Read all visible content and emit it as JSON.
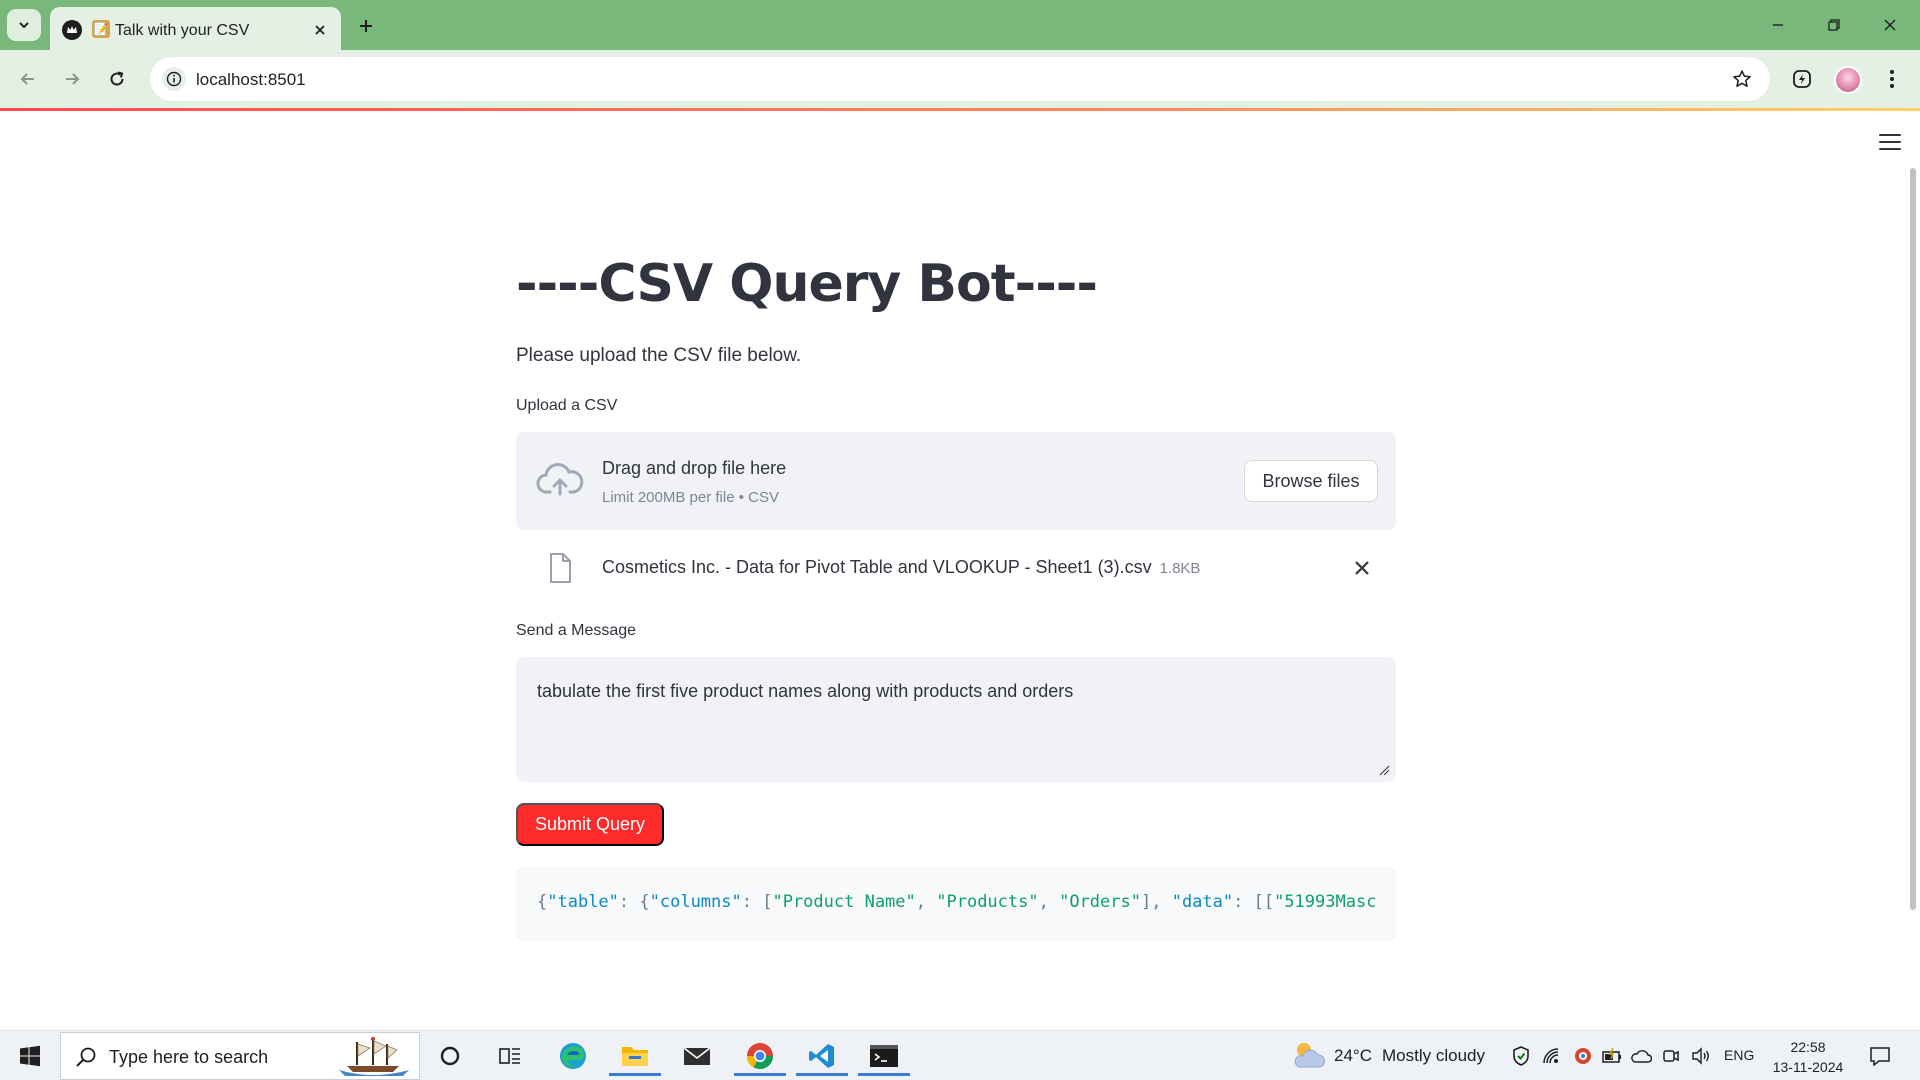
{
  "browser": {
    "tab_title": "Talk with your CSV",
    "tab_emoji": "📝",
    "url": "localhost:8501",
    "theme_color": "#78b87a"
  },
  "app": {
    "title": "----CSV Query Bot----",
    "subtitle": "Please upload the CSV file below.",
    "upload_label": "Upload a CSV",
    "dropzone": {
      "main": "Drag and drop file here",
      "limit": "Limit 200MB per file • CSV",
      "browse_label": "Browse files"
    },
    "uploaded_file": {
      "name": "Cosmetics Inc. - Data for Pivot Table and VLOOKUP - Sheet1 (3).csv",
      "size": "1.8KB"
    },
    "message_label": "Send a Message",
    "message_value": "tabulate the first five product names along with products and orders",
    "submit_label": "Submit Query",
    "submit_color": "#ff2b2b",
    "output_json_tokens": [
      {
        "t": "{",
        "k": "punc"
      },
      {
        "t": "\"table\"",
        "k": "key"
      },
      {
        "t": ": {",
        "k": "punc"
      },
      {
        "t": "\"columns\"",
        "k": "key"
      },
      {
        "t": ": [",
        "k": "punc"
      },
      {
        "t": "\"Product Name\"",
        "k": "str"
      },
      {
        "t": ", ",
        "k": "punc"
      },
      {
        "t": "\"Products\"",
        "k": "str"
      },
      {
        "t": ", ",
        "k": "punc"
      },
      {
        "t": "\"Orders\"",
        "k": "str"
      },
      {
        "t": "], ",
        "k": "punc"
      },
      {
        "t": "\"data\"",
        "k": "key"
      },
      {
        "t": ": [[",
        "k": "punc"
      },
      {
        "t": "\"51993Masc",
        "k": "str"
      }
    ]
  },
  "taskbar": {
    "search_placeholder": "Type here to search",
    "weather_temp": "24°C",
    "weather_condition": "Mostly cloudy",
    "language": "ENG",
    "time": "22:58",
    "date": "13-11-2024",
    "pinned_apps": [
      "cortana-icon",
      "task-view-icon",
      "edge-icon",
      "file-explorer-icon",
      "mail-icon",
      "chrome-icon",
      "vscode-icon",
      "terminal-icon"
    ],
    "tray_icons": [
      "security-icon",
      "network-icon",
      "app-tray-icon",
      "battery-icon",
      "onedrive-icon",
      "meet-icon",
      "volume-icon"
    ]
  }
}
